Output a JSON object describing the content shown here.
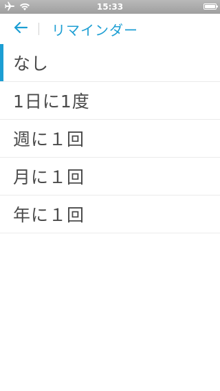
{
  "status_bar": {
    "time": "15:33",
    "icons": [
      "airplane-icon",
      "wifi-icon",
      "battery-icon"
    ]
  },
  "header": {
    "back_icon": "arrow-left-icon",
    "title": "リマインダー"
  },
  "reminder_options": [
    {
      "label": "なし",
      "selected": true
    },
    {
      "label": "1日に1度",
      "selected": false
    },
    {
      "label": "週に１回",
      "selected": false
    },
    {
      "label": "月に１回",
      "selected": false
    },
    {
      "label": "年に１回",
      "selected": false
    }
  ],
  "colors": {
    "accent": "#1c9ed3",
    "text": "#4a4a4a",
    "divider": "#ebebeb",
    "status_bar": "#a8a8a8"
  }
}
